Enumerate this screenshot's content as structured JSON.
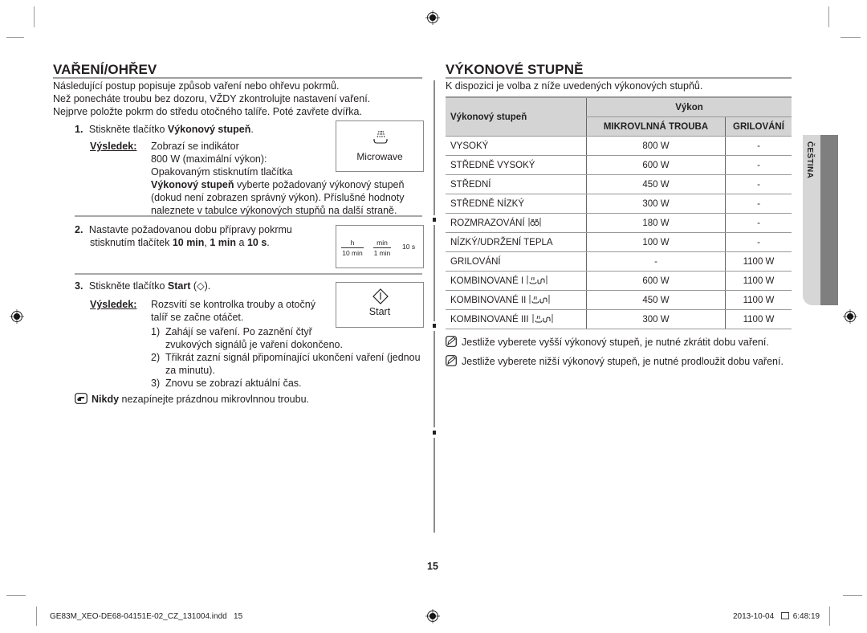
{
  "left": {
    "title": "VAŘENÍ/OHŘEV",
    "intro": [
      "Následující postup popisuje způsob vaření nebo ohřevu pokrmů.",
      "Než ponecháte troubu bez dozoru, VŽDY zkontrolujte nastavení vaření.",
      "Nejprve položte pokrm do středu otočného talíře. Poté zavřete dvířka."
    ],
    "step1": {
      "num": "1.",
      "text_pre": "Stiskněte tlačítko ",
      "text_bold": "Výkonový stupeň",
      "text_post": ".",
      "result_label": "Výsledek:",
      "result_lines": [
        "Zobrazí se indikátor",
        "800 W (maximální výkon):",
        "Opakovaným stisknutím tlačítka"
      ],
      "result_bold": "Výkonový stupeň",
      "result_cont": " vyberte požadovaný výkonový stupeň",
      "result_lines2": [
        "(dokud není zobrazen správný výkon). Příslušné hodnoty",
        "naleznete v tabulce výkonových stupňů na další straně."
      ],
      "panel_label": "Microwave",
      "panel_icon": "microwave-icon"
    },
    "step2": {
      "num": "2.",
      "line1": "Nastavte požadovanou dobu přípravy pokrmu",
      "line2_pre": "stisknutím tlačítek ",
      "b1": "10 min",
      "sep1": ", ",
      "b2": "1 min",
      "sep2": " a ",
      "b3": "10 s",
      "end": ".",
      "panel": {
        "btn1_top": "h",
        "btn1_bottom": "10 min",
        "btn2_top": "min",
        "btn2_bottom": "1 min",
        "btn3": "10 s"
      }
    },
    "step3": {
      "num": "3.",
      "text_pre": "Stiskněte tlačítko ",
      "text_bold": "Start",
      "text_post": " (◇).",
      "result_label": "Výsledek:",
      "result_lines": [
        "Rozsvítí se kontrolka trouby a otočný",
        "talíř se začne otáčet."
      ],
      "sub": [
        {
          "n": "1)",
          "lines": [
            "Zahájí se vaření. Po zaznění čtyř",
            "zvukových signálů je vaření dokončeno."
          ]
        },
        {
          "n": "2)",
          "lines": [
            "Třikrát zazní signál připomínající ukončení vaření (jednou",
            "za minutu)."
          ]
        },
        {
          "n": "3)",
          "lines": [
            "Znovu se zobrazí aktuální čas."
          ]
        }
      ],
      "panel_label": "Start",
      "panel_icon": "start-icon"
    },
    "warning": {
      "icon": "pointing-hand-icon",
      "bold": "Nikdy",
      "text": " nezapínejte prázdnou mikrovlnnou troubu."
    }
  },
  "right": {
    "title": "VÝKONOVÉ STUPNĚ",
    "intro": "K dispozici je volba z níže uvedených výkonových stupňů.",
    "table": {
      "header_level": "Výkonový stupeň",
      "header_power": "Výkon",
      "header_micro": "MIKROVLNNÁ TROUBA",
      "header_grill": "GRILOVÁNÍ",
      "rows": [
        {
          "name": "VYSOKÝ",
          "micro": "800 W",
          "grill": "-"
        },
        {
          "name": "STŘEDNĚ VYSOKÝ",
          "micro": "600 W",
          "grill": "-"
        },
        {
          "name": "STŘEDNÍ",
          "micro": "450 W",
          "grill": "-"
        },
        {
          "name": "STŘEDNĚ NÍZKÝ",
          "micro": "300 W",
          "grill": "-"
        },
        {
          "name": "ROZMRAZOVÁNÍ",
          "icon": "defrost-icon",
          "micro": "180 W",
          "grill": "-"
        },
        {
          "name": "NÍZKÝ/UDRŽENÍ TEPLA",
          "micro": "100 W",
          "grill": "-"
        },
        {
          "name": "GRILOVÁNÍ",
          "micro": "-",
          "grill": "1100 W"
        },
        {
          "name": "KOMBINOVANÉ I",
          "icon": "combi-icon",
          "micro": "600 W",
          "grill": "1100 W"
        },
        {
          "name": "KOMBINOVANÉ II",
          "icon": "combi-icon",
          "micro": "450 W",
          "grill": "1100 W"
        },
        {
          "name": "KOMBINOVANÉ III",
          "icon": "combi-icon",
          "micro": "300 W",
          "grill": "1100 W"
        }
      ]
    },
    "notes": [
      "Jestliže vyberete vyšší výkonový stupeň, je nutné zkrátit dobu vaření.",
      "Jestliže vyberete nižší výkonový stupeň, je nutné prodloužit dobu vaření."
    ],
    "side_tab": "ČEŠTINA"
  },
  "page_number": "15",
  "footer": {
    "file": "GE83M_XEO-DE68-04151E-02_CZ_131004.indd   15",
    "date": "2013-10-04",
    "time": "6:48:19"
  }
}
